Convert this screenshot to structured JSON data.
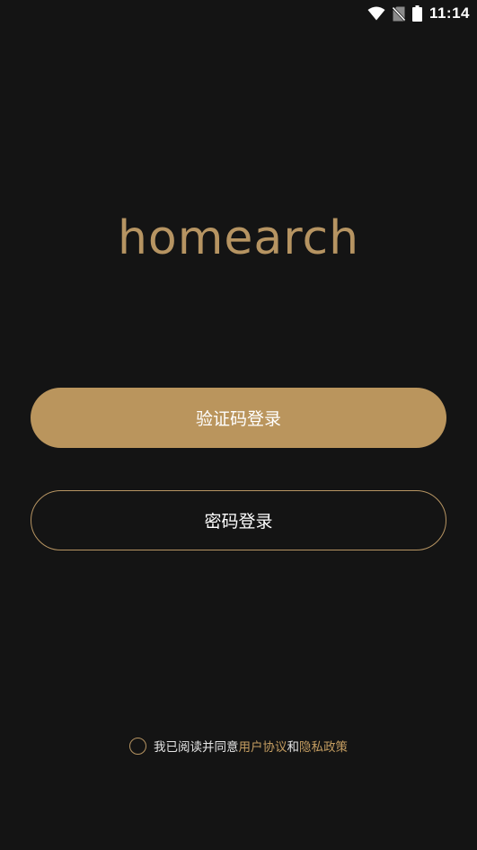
{
  "status_bar": {
    "time": "11:14",
    "icons": [
      "wifi-icon",
      "no-sim-icon",
      "battery-icon"
    ]
  },
  "logo": {
    "text": "homearch"
  },
  "buttons": {
    "sms_login": "验证码登录",
    "password_login": "密码登录"
  },
  "agreement": {
    "prefix": "我已阅读并同意",
    "user_agreement": "用户协议",
    "conjunction": "和",
    "privacy_policy": "隐私政策",
    "checked": false
  },
  "colors": {
    "background": "#141414",
    "accent": "#ba955d",
    "link": "#c49d61"
  }
}
